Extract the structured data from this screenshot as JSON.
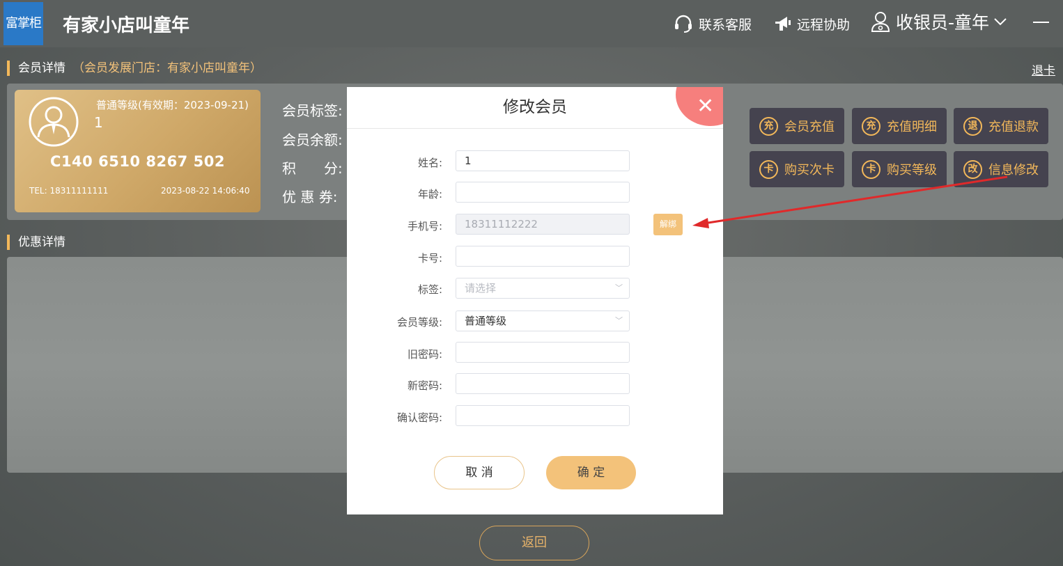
{
  "header": {
    "logo_text": "富掌柜",
    "shop_name": "有家小店叫童年",
    "support_label": "联系客服",
    "remote_label": "远程协助",
    "cashier_label": "收银员-童年"
  },
  "member_section": {
    "title": "会员详情",
    "subtitle": "（会员发展门店：有家小店叫童年）",
    "exit_card": "退卡"
  },
  "card": {
    "level": "普通等级(有效期：2023-09-21)",
    "name": "1",
    "card_number": "C140 6510 8267 502",
    "tel": "TEL: 18311111111",
    "time": "2023-08-22 14:06:40"
  },
  "info_labels": [
    "会员标签:",
    "会员余额:",
    "积　　分:",
    "优 惠 券:"
  ],
  "actions": [
    {
      "icon": "充",
      "label": "会员充值"
    },
    {
      "icon": "充",
      "label": "充值明细"
    },
    {
      "icon": "退",
      "label": "充值退款"
    },
    {
      "icon": "卡",
      "label": "购买次卡"
    },
    {
      "icon": "卡",
      "label": "购买等级"
    },
    {
      "icon": "改",
      "label": "信息修改"
    }
  ],
  "discount_section": {
    "title": "优惠详情"
  },
  "back_label": "返回",
  "modal": {
    "title": "修改会员",
    "fields": {
      "name": {
        "label": "姓名:",
        "value": "1"
      },
      "age": {
        "label": "年龄:",
        "value": ""
      },
      "phone": {
        "label": "手机号:",
        "value": "18311112222"
      },
      "card_no": {
        "label": "卡号:",
        "value": ""
      },
      "tag": {
        "label": "标签:",
        "placeholder": "请选择"
      },
      "level": {
        "label": "会员等级:",
        "value": "普通等级"
      },
      "old_password": {
        "label": "旧密码:",
        "value": ""
      },
      "new_password": {
        "label": "新密码:",
        "value": ""
      },
      "confirm_password": {
        "label": "确认密码:",
        "value": ""
      }
    },
    "unbind_label": "解绑",
    "cancel_label": "取 消",
    "ok_label": "确 定"
  },
  "colors": {
    "accent": "#f3b85a",
    "close": "#f67f7d",
    "arrow": "#e0292a",
    "logo_bg": "#2a79c7"
  }
}
